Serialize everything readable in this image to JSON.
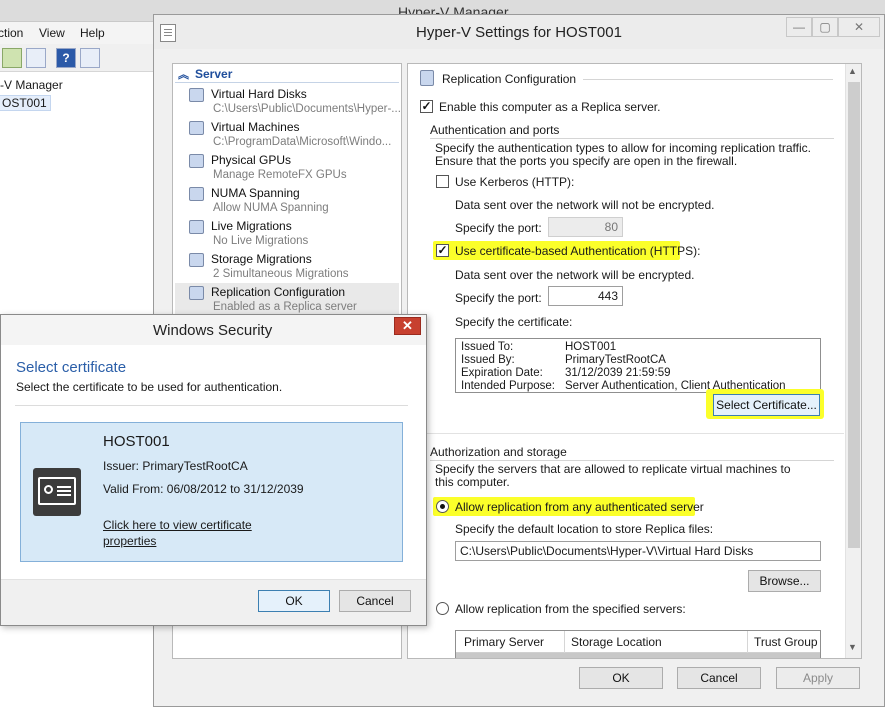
{
  "manager": {
    "title": "Hyper-V Manager",
    "menu": [
      "ction",
      "View",
      "Help"
    ],
    "tree_root": "r-V Manager",
    "tree_host": "OST001"
  },
  "settings": {
    "title": "Hyper-V Settings for HOST001",
    "window_controls": [
      "—",
      "▢",
      "✕"
    ],
    "nav": {
      "header": "Server",
      "items": [
        {
          "label": "Virtual Hard Disks",
          "sub": "C:\\Users\\Public\\Documents\\Hyper-..."
        },
        {
          "label": "Virtual Machines",
          "sub": "C:\\ProgramData\\Microsoft\\Windo..."
        },
        {
          "label": "Physical GPUs",
          "sub": "Manage RemoteFX GPUs"
        },
        {
          "label": "NUMA Spanning",
          "sub": "Allow NUMA Spanning"
        },
        {
          "label": "Live Migrations",
          "sub": "No Live Migrations"
        },
        {
          "label": "Storage Migrations",
          "sub": "2 Simultaneous Migrations"
        },
        {
          "label": "Replication Configuration",
          "sub": "Enabled as a Replica server"
        }
      ]
    },
    "replication": {
      "section_title": "Replication Configuration",
      "enable_label": "Enable this computer as a Replica server.",
      "enable_checked": true,
      "auth_group_title": "Authentication and ports",
      "auth_desc": "Specify the authentication types to allow for incoming replication traffic. Ensure that the ports you specify are open in the firewall.",
      "kerberos_label": "Use Kerberos (HTTP):",
      "kerberos_checked": false,
      "kerberos_note": "Data sent over the network will not be encrypted.",
      "kerberos_port_label": "Specify the port:",
      "kerberos_port": "80",
      "cert_auth_label": "Use certificate-based Authentication (HTTPS):",
      "cert_auth_checked": true,
      "cert_note": "Data sent over the network will be encrypted.",
      "cert_port_label": "Specify the port:",
      "cert_port": "443",
      "cert_label": "Specify the certificate:",
      "certificate": {
        "issued_to_k": "Issued To:",
        "issued_to": "HOST001",
        "issued_by_k": "Issued By:",
        "issued_by": "PrimaryTestRootCA",
        "expiration_k": "Expiration Date:",
        "expiration": "31/12/2039 21:59:59",
        "purpose_k": "Intended Purpose:",
        "purpose": "Server Authentication, Client Authentication"
      },
      "select_cert_button": "Select Certificate...",
      "authz_group_title": "Authorization and storage",
      "authz_desc": "Specify the servers that are allowed to replicate virtual machines to this computer.",
      "allow_any_label": "Allow replication from any authenticated server",
      "default_location_label": "Specify the default location to store Replica files:",
      "default_location": "C:\\Users\\Public\\Documents\\Hyper-V\\Virtual Hard Disks",
      "browse_button": "Browse...",
      "allow_specified_label": "Allow replication from the specified servers:",
      "table_headers": [
        "Primary Server",
        "Storage Location",
        "Trust Group"
      ]
    },
    "buttons": {
      "ok": "OK",
      "cancel": "Cancel",
      "apply": "Apply"
    },
    "highlight_color": "#fbff2a"
  },
  "security": {
    "title": "Windows Security",
    "close": "✕",
    "heading": "Select certificate",
    "subheading": "Select the certificate to be used for authentication.",
    "tile": {
      "name": "HOST001",
      "issuer": "Issuer: PrimaryTestRootCA",
      "valid": "Valid From: 06/08/2012 to 31/12/2039",
      "link": "Click here to view certificate properties"
    },
    "buttons": {
      "ok": "OK",
      "cancel": "Cancel"
    }
  }
}
